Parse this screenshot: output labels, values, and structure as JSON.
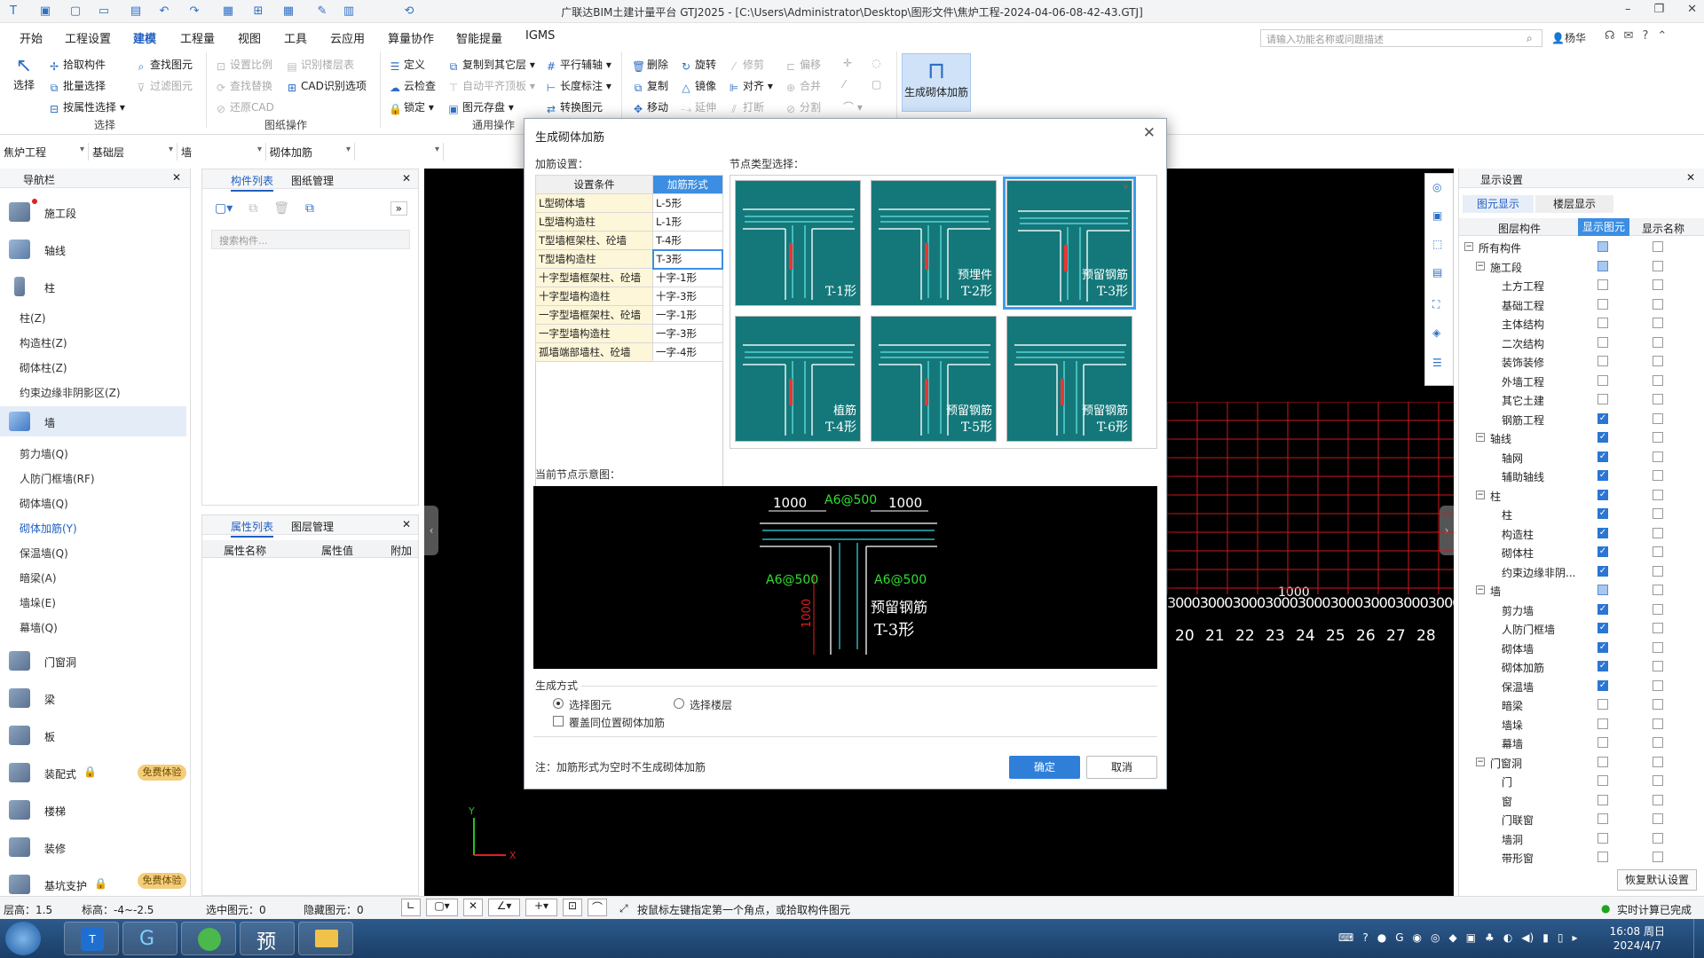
{
  "app": {
    "title": "广联达BIM土建计量平台 GTJ2025 - [C:\\Users\\Administrator\\Desktop\\图形文件\\焦炉工程-2024-04-06-08-42-43.GTJ]"
  },
  "menu": {
    "items": [
      "开始",
      "工程设置",
      "建模",
      "工程量",
      "视图",
      "工具",
      "云应用",
      "算量协作",
      "智能提量",
      "IGMS"
    ],
    "active": "建模",
    "search_placeholder": "请输入功能名称或问题描述",
    "user": "杨华"
  },
  "ribbon": {
    "select_big": "选择",
    "select_btns": [
      "拾取构件",
      "批量选择",
      "按属性选择"
    ],
    "find_btns": [
      "查找图元",
      "过滤图元"
    ],
    "group_select": "选择",
    "drawing_btns": [
      "设置比例",
      "查找替换",
      "还原CAD",
      "识别楼层表",
      "CAD识别选项"
    ],
    "group_drawing": "图纸操作",
    "common_btns": [
      "定义",
      "云检查",
      "锁定",
      "复制到其它层",
      "自动平齐顶板",
      "图元存盘",
      "平行辅轴",
      "长度标注",
      "转换图元"
    ],
    "group_common": "通用操作",
    "modify_btns": [
      "删除",
      "复制",
      "移动",
      "旋转",
      "镜像",
      "延伸",
      "修剪",
      "对齐",
      "打断",
      "偏移",
      "合并",
      "分割"
    ],
    "gen_button": "生成砌体加筋"
  },
  "selectors": [
    "焦炉工程",
    "基础层",
    "墙",
    "砌体加筋"
  ],
  "nav": {
    "header": "导航栏",
    "items": [
      {
        "label": "施工段"
      },
      {
        "label": "轴线"
      },
      {
        "label": "柱"
      }
    ],
    "col_sub": [
      "柱(Z)",
      "构造柱(Z)",
      "砌体柱(Z)",
      "约束边缘非阴影区(Z)"
    ],
    "wall": "墙",
    "wall_sub": [
      "剪力墙(Q)",
      "人防门框墙(RF)",
      "砌体墙(Q)",
      "砌体加筋(Y)",
      "保温墙(Q)",
      "暗梁(A)",
      "墙垛(E)",
      "幕墙(Q)"
    ],
    "items2": [
      "门窗洞",
      "梁",
      "板",
      "装配式",
      "楼梯",
      "装修",
      "基坑支护"
    ],
    "badge": "免费体验"
  },
  "comp_panel": {
    "tabs": [
      "构件列表",
      "图纸管理"
    ],
    "search_placeholder": "搜索构件..."
  },
  "prop_panel": {
    "tabs": [
      "属性列表",
      "图层管理"
    ],
    "cols": [
      "属性名称",
      "属性值",
      "附加"
    ]
  },
  "dialog": {
    "title": "生成砌体加筋",
    "cfg_label": "加筋设置：",
    "node_label": "节点类型选择：",
    "table_head": [
      "设置条件",
      "加筋形式"
    ],
    "rows": [
      [
        "L型砌体墙",
        "L-5形"
      ],
      [
        "L型墙构造柱",
        "L-1形"
      ],
      [
        "T型墙框架柱、砼墙",
        "T-4形"
      ],
      [
        "T型墙构造柱",
        "T-3形"
      ],
      [
        "十字型墙框架柱、砼墙",
        "十字-1形"
      ],
      [
        "十字型墙构造柱",
        "十字-3形"
      ],
      [
        "一字型墙框架柱、砼墙",
        "一字-1形"
      ],
      [
        "一字型墙构造柱",
        "一字-3形"
      ],
      [
        "孤墙端部墙柱、砼墙",
        "一字-4形"
      ]
    ],
    "nodes": [
      {
        "label": "T-1形",
        "sub": ""
      },
      {
        "label": "T-2形",
        "sub": "预埋件"
      },
      {
        "label": "T-3形",
        "sub": "预留钢筋"
      },
      {
        "label": "T-4形",
        "sub": "植筋"
      },
      {
        "label": "T-5形",
        "sub": "预留钢筋"
      },
      {
        "label": "T-6形",
        "sub": "预留钢筋"
      }
    ],
    "preview_label": "当前节点示意图：",
    "preview": {
      "top_left": "1000",
      "top_mid": "A6@500",
      "top_right": "1000",
      "left": "A6@500",
      "right": "A6@500",
      "vert": "1000",
      "caption1": "预留钢筋",
      "caption2": "T-3形"
    },
    "gen_label": "生成方式",
    "radio1": "选择图元",
    "radio2": "选择楼层",
    "checkbox": "覆盖同位置砌体加筋",
    "note": "注：加筋形式为空时不生成砌体加筋",
    "ok": "确定",
    "cancel": "取消"
  },
  "canvas": {
    "axis_nums": [
      "20",
      "21",
      "22",
      "23",
      "24",
      "25",
      "26",
      "27",
      "28"
    ],
    "dims": "3000",
    "dim_top": "1000"
  },
  "display": {
    "header": "显示设置",
    "tabs": [
      "图元显示",
      "楼层显示"
    ],
    "cols": [
      "图层构件",
      "显示图元",
      "显示名称"
    ],
    "rows": [
      {
        "name": "所有构件",
        "lvl": 0,
        "t": "-",
        "a": "part",
        "b": "off"
      },
      {
        "name": "施工段",
        "lvl": 1,
        "t": "-",
        "a": "part",
        "b": "off"
      },
      {
        "name": "土方工程",
        "lvl": 2,
        "a": "off",
        "b": "off"
      },
      {
        "name": "基础工程",
        "lvl": 2,
        "a": "off",
        "b": "off"
      },
      {
        "name": "主体结构",
        "lvl": 2,
        "a": "off",
        "b": "off"
      },
      {
        "name": "二次结构",
        "lvl": 2,
        "a": "off",
        "b": "off"
      },
      {
        "name": "装饰装修",
        "lvl": 2,
        "a": "off",
        "b": "off"
      },
      {
        "name": "外墙工程",
        "lvl": 2,
        "a": "off",
        "b": "off"
      },
      {
        "name": "其它土建",
        "lvl": 2,
        "a": "off",
        "b": "off"
      },
      {
        "name": "钢筋工程",
        "lvl": 2,
        "a": "on",
        "b": "off"
      },
      {
        "name": "轴线",
        "lvl": 1,
        "t": "-",
        "a": "on",
        "b": "off"
      },
      {
        "name": "轴网",
        "lvl": 2,
        "a": "on",
        "b": "off"
      },
      {
        "name": "辅助轴线",
        "lvl": 2,
        "a": "on",
        "b": "off"
      },
      {
        "name": "柱",
        "lvl": 1,
        "t": "-",
        "a": "on",
        "b": "off"
      },
      {
        "name": "柱",
        "lvl": 2,
        "a": "on",
        "b": "off"
      },
      {
        "name": "构造柱",
        "lvl": 2,
        "a": "on",
        "b": "off"
      },
      {
        "name": "砌体柱",
        "lvl": 2,
        "a": "on",
        "b": "off"
      },
      {
        "name": "约束边缘非阴...",
        "lvl": 2,
        "a": "on",
        "b": "off"
      },
      {
        "name": "墙",
        "lvl": 1,
        "t": "-",
        "a": "part",
        "b": "off"
      },
      {
        "name": "剪力墙",
        "lvl": 2,
        "a": "on",
        "b": "off"
      },
      {
        "name": "人防门框墙",
        "lvl": 2,
        "a": "on",
        "b": "off"
      },
      {
        "name": "砌体墙",
        "lvl": 2,
        "a": "on",
        "b": "off"
      },
      {
        "name": "砌体加筋",
        "lvl": 2,
        "a": "on",
        "b": "off"
      },
      {
        "name": "保温墙",
        "lvl": 2,
        "a": "on",
        "b": "off"
      },
      {
        "name": "暗梁",
        "lvl": 2,
        "a": "off",
        "b": "off"
      },
      {
        "name": "墙垛",
        "lvl": 2,
        "a": "off",
        "b": "off"
      },
      {
        "name": "幕墙",
        "lvl": 2,
        "a": "off",
        "b": "off"
      },
      {
        "name": "门窗洞",
        "lvl": 1,
        "t": "-",
        "a": "off",
        "b": "off"
      },
      {
        "name": "门",
        "lvl": 2,
        "a": "off",
        "b": "off"
      },
      {
        "name": "窗",
        "lvl": 2,
        "a": "off",
        "b": "off"
      },
      {
        "name": "门联窗",
        "lvl": 2,
        "a": "off",
        "b": "off"
      },
      {
        "name": "墙洞",
        "lvl": 2,
        "a": "off",
        "b": "off"
      },
      {
        "name": "带形窗",
        "lvl": 2,
        "a": "off",
        "b": "off"
      }
    ],
    "restore": "恢复默认设置"
  },
  "status": {
    "floor_h": "层高：1.5",
    "elev": "标高：-4~-2.5",
    "selected": "选中图元：0",
    "hidden": "隐藏图元：0",
    "hint": "按鼠标左键指定第一个角点，或拾取构件图元",
    "calc": "实时计算已完成"
  },
  "taskbar": {
    "app_label": "预",
    "time": "16:08 周日",
    "date": "2024/4/7"
  },
  "colors": {
    "accent": "#2f7fd9",
    "node_bg": "#14787a",
    "grid": "#d0191b"
  }
}
